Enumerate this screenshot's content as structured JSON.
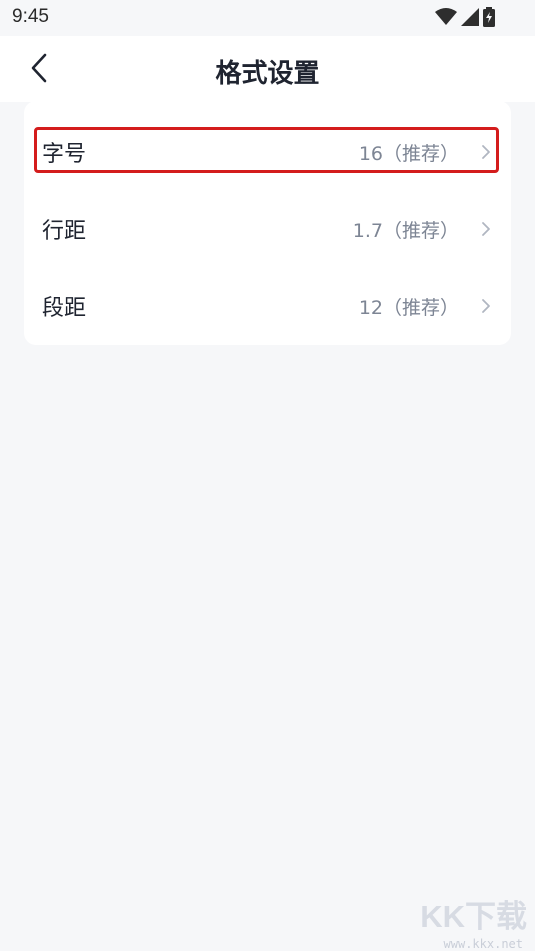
{
  "status_bar": {
    "time": "9:45",
    "icons": [
      "wifi-icon",
      "cellular-signal-icon",
      "battery-charging-icon"
    ]
  },
  "header": {
    "title": "格式设置",
    "back_icon": "chevron-left-icon"
  },
  "settings": {
    "items": [
      {
        "label": "字号",
        "value": "16（推荐）",
        "highlighted": true
      },
      {
        "label": "行距",
        "value": "1.7（推荐）",
        "highlighted": false
      },
      {
        "label": "段距",
        "value": "12（推荐）",
        "highlighted": false
      }
    ]
  },
  "watermark": {
    "text": "KK下载",
    "subtext": "www.kkx.net"
  },
  "colors": {
    "background": "#f6f7f9",
    "card": "#ffffff",
    "highlight_border": "#d41c1c",
    "value_text": "#7d8594",
    "title_text": "#1f2430"
  }
}
